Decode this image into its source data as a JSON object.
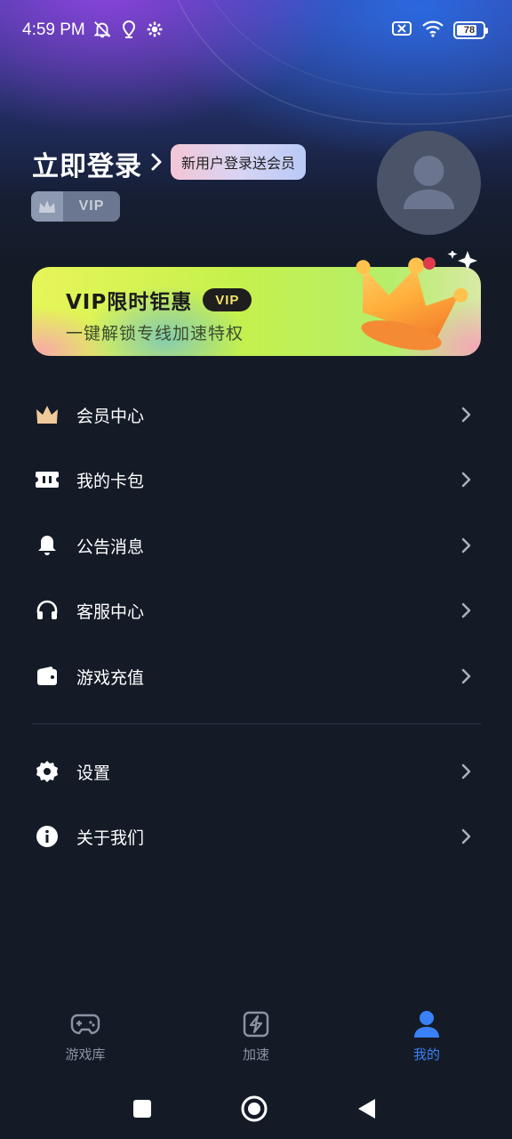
{
  "status_bar": {
    "time": "4:59 PM",
    "battery": "78",
    "battery_level": 0.78,
    "icons": [
      "muted-bell-icon",
      "location-icon",
      "settings-gear-icon",
      "no-sim-icon",
      "wifi-icon",
      "battery-icon"
    ]
  },
  "header": {
    "login_title": "立即登录",
    "login_badge": "新用户登录送会员",
    "vip_label": "VIP"
  },
  "promo": {
    "title": "VIP限时钜惠",
    "tag": "VIP",
    "subtitle": "一键解锁专线加速特权"
  },
  "menu": {
    "items": [
      {
        "label": "会员中心",
        "icon": "crown-icon"
      },
      {
        "label": "我的卡包",
        "icon": "ticket-icon"
      },
      {
        "label": "公告消息",
        "icon": "bell-icon"
      },
      {
        "label": "客服中心",
        "icon": "headset-icon"
      },
      {
        "label": "游戏充值",
        "icon": "wallet-icon"
      }
    ],
    "items2": [
      {
        "label": "设置",
        "icon": "gear-icon"
      },
      {
        "label": "关于我们",
        "icon": "info-icon"
      }
    ]
  },
  "bottom_nav": {
    "items": [
      {
        "label": "游戏库",
        "icon": "gamepad-icon",
        "active": false
      },
      {
        "label": "加速",
        "icon": "lightning-icon",
        "active": false
      },
      {
        "label": "我的",
        "icon": "person-icon",
        "active": true
      }
    ]
  },
  "colors": {
    "background": "#141b27",
    "accent": "#3a80f6",
    "promo_green": "#c6f14c"
  }
}
